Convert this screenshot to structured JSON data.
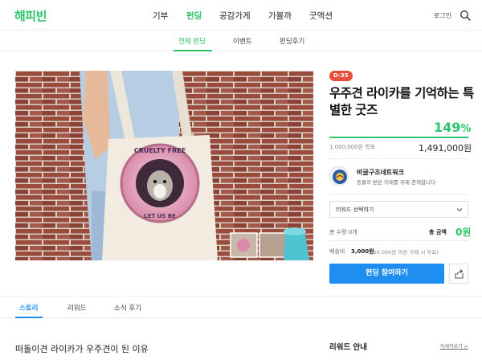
{
  "header": {
    "logo": "해피빈",
    "menu": [
      "기부",
      "펀딩",
      "공감가게",
      "가볼까",
      "굿액션"
    ],
    "active_menu": "펀딩",
    "login": "로그인",
    "search_icon": "search-icon"
  },
  "subnav": {
    "tabs": [
      "전체 펀딩",
      "이벤트",
      "펀딩후기"
    ],
    "active_tab": "전체 펀딩"
  },
  "hero": {
    "badge_top": "CRUELTY FREE",
    "badge_bottom": "LET US BE"
  },
  "product": {
    "dday": "D-35",
    "title": "우주견 라이카를 기억하는 특별한 굿즈",
    "percent_value": "149",
    "percent_unit": "%",
    "progress": 1.0,
    "goal": "1,000,000원 목표",
    "raised": "1,491,000원",
    "org_name": "비글구조네트워크",
    "org_slogan": "동물의 받은 이래를 위해 존재합니다",
    "reward_select": "리워드 선택하기",
    "quantity": "총 수량 0개",
    "total_label": "총 금액",
    "total_value": "0원",
    "shipping_label": "배송비",
    "shipping_value": "3,000원",
    "shipping_note": "(50,000원 이상 구매 시 무료)",
    "cta": "펀딩 참여하기"
  },
  "content": {
    "tabs": [
      "스토리",
      "리워드",
      "소식 후기"
    ],
    "active_tab": "스토리",
    "story_heading": "떠돌이견 라이카가 우주견이 된 이유",
    "reward_heading": "리워드 안내",
    "reward_more": "자세히보기 >"
  },
  "colors": {
    "brand_green": "#2dc36a",
    "cta_blue": "#1f8ef1",
    "dday_red": "#e94e3a"
  }
}
